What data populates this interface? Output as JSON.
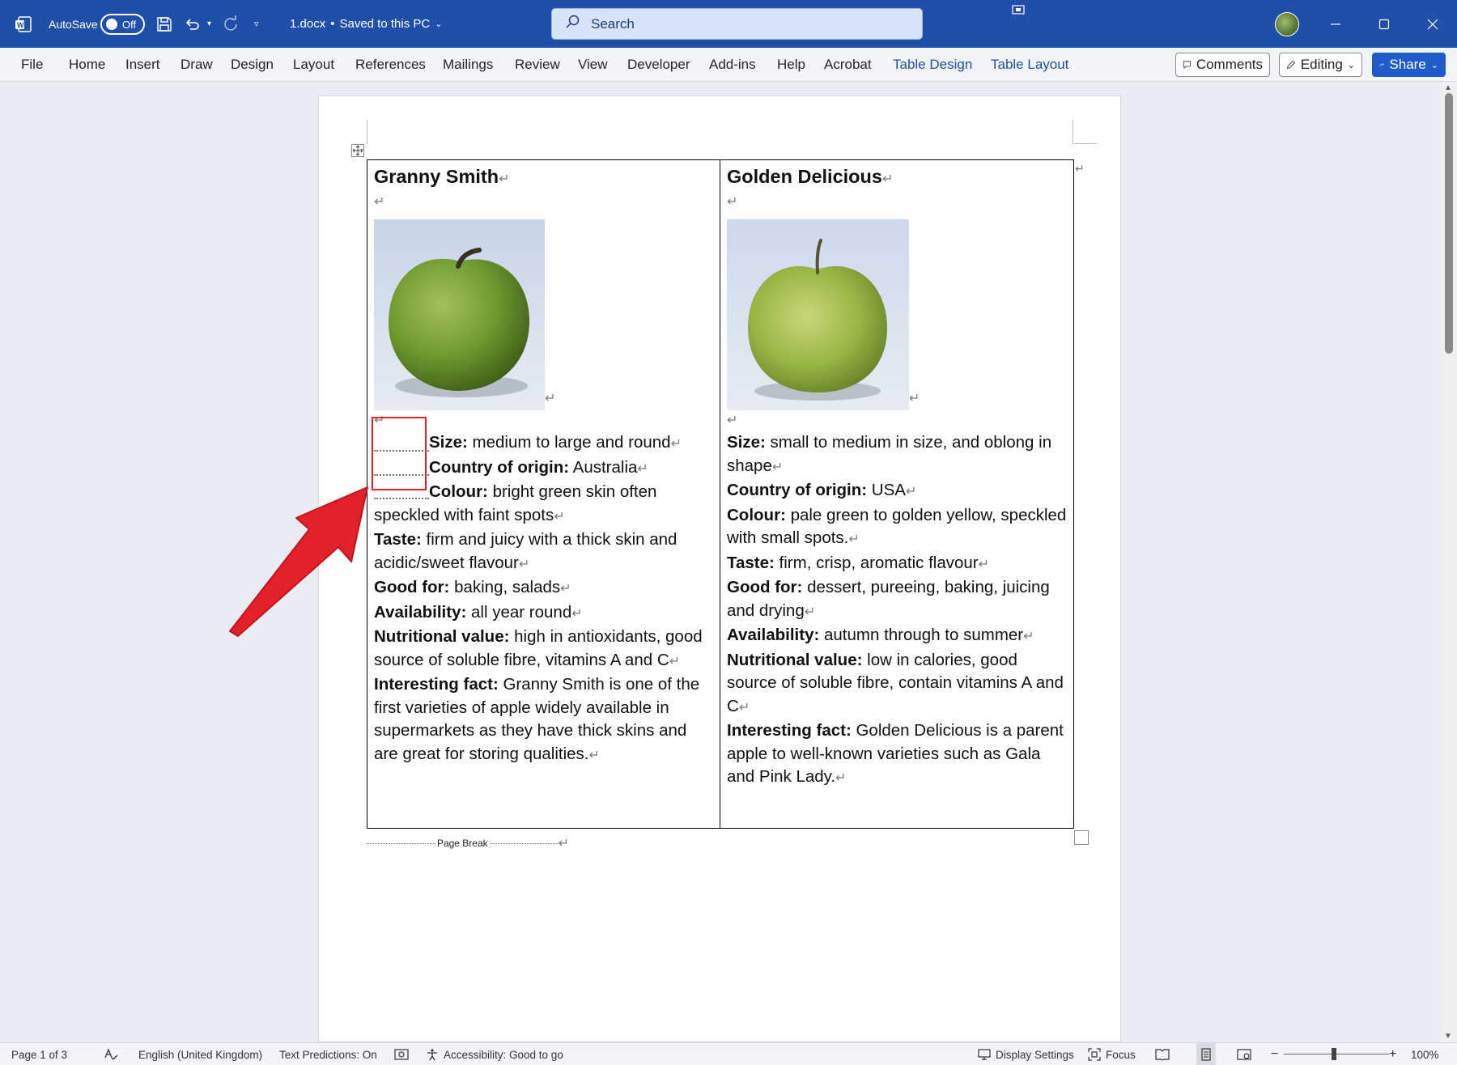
{
  "titlebar": {
    "autosave_label": "AutoSave",
    "autosave_state": "Off",
    "filename": "1.docx",
    "save_status": "Saved to this PC",
    "separator": "•",
    "search_placeholder": "Search"
  },
  "ribbon": {
    "tabs": [
      "File",
      "Home",
      "Insert",
      "Draw",
      "Design",
      "Layout",
      "References",
      "Mailings",
      "Review",
      "View",
      "Developer",
      "Add-ins",
      "Help",
      "Acrobat",
      "Table Design",
      "Table Layout"
    ],
    "comments_label": "Comments",
    "editing_label": "Editing",
    "share_label": "Share"
  },
  "document": {
    "page_break_label": "Page Break",
    "left": {
      "title": "Granny Smith",
      "rows": [
        {
          "label": "Size:",
          "text": " medium to large and round",
          "lead": true
        },
        {
          "label": "Country of origin:",
          "text": " Australia",
          "lead": true
        },
        {
          "label": "Colour:",
          "text": " bright green skin often speckled with faint spots",
          "lead": true
        },
        {
          "label": "Taste:",
          "text": " firm and juicy with a thick skin and acidic/sweet flavour"
        },
        {
          "label": "Good for:",
          "text": " baking, salads"
        },
        {
          "label": "Availability:",
          "text": " all year round"
        },
        {
          "label": "Nutritional value:",
          "text": " high in antioxidants, good source of soluble fibre, vitamins A and C"
        },
        {
          "label": "Interesting fact:",
          "text": " Granny Smith is one of the first varieties of apple widely available in supermarkets as they have thick skins and are great for storing qualities."
        }
      ]
    },
    "right": {
      "title": "Golden Delicious",
      "rows": [
        {
          "label": "Size:",
          "text": " small to medium in size, and oblong in shape"
        },
        {
          "label": "Country of origin:",
          "text": " USA"
        },
        {
          "label": "Colour:",
          "text": " pale green to golden yellow, speckled with small spots."
        },
        {
          "label": "Taste:",
          "text": " firm, crisp, aromatic flavour"
        },
        {
          "label": "Good for:",
          "text": " dessert, pureeing, baking, juicing and drying"
        },
        {
          "label": "Availability:",
          "text": " autumn through to summer"
        },
        {
          "label": "Nutritional value:",
          "text": " low in calories, good source of soluble fibre, contain vitamins A and C"
        },
        {
          "label": "Interesting fact:",
          "text": " Golden Delicious is a parent apple to well-known varieties such as Gala and Pink Lady."
        }
      ]
    }
  },
  "statusbar": {
    "page": "Page 1 of 3",
    "language": "English (United Kingdom)",
    "predictions": "Text Predictions: On",
    "accessibility": "Accessibility: Good to go",
    "display_settings": "Display Settings",
    "focus": "Focus",
    "zoom": "100%"
  },
  "colors": {
    "titlebar": "#1f4fa8",
    "accent_tab": "#1f4fa8",
    "share": "#1f5bc9",
    "highlight": "#e3212b"
  }
}
